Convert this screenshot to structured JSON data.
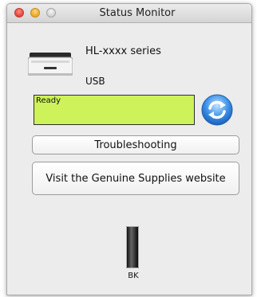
{
  "window": {
    "title": "Status Monitor"
  },
  "printer": {
    "icon": "printer-icon",
    "model": "HL-xxxx series",
    "connection": "USB"
  },
  "status": {
    "text": "Ready",
    "color": "#cdf25a"
  },
  "refresh": {
    "icon": "refresh-icon"
  },
  "buttons": {
    "troubleshooting": "Troubleshooting",
    "supplies": "Visit the Genuine Supplies website"
  },
  "toner": {
    "label": "BK",
    "level_fraction": 1.0
  }
}
